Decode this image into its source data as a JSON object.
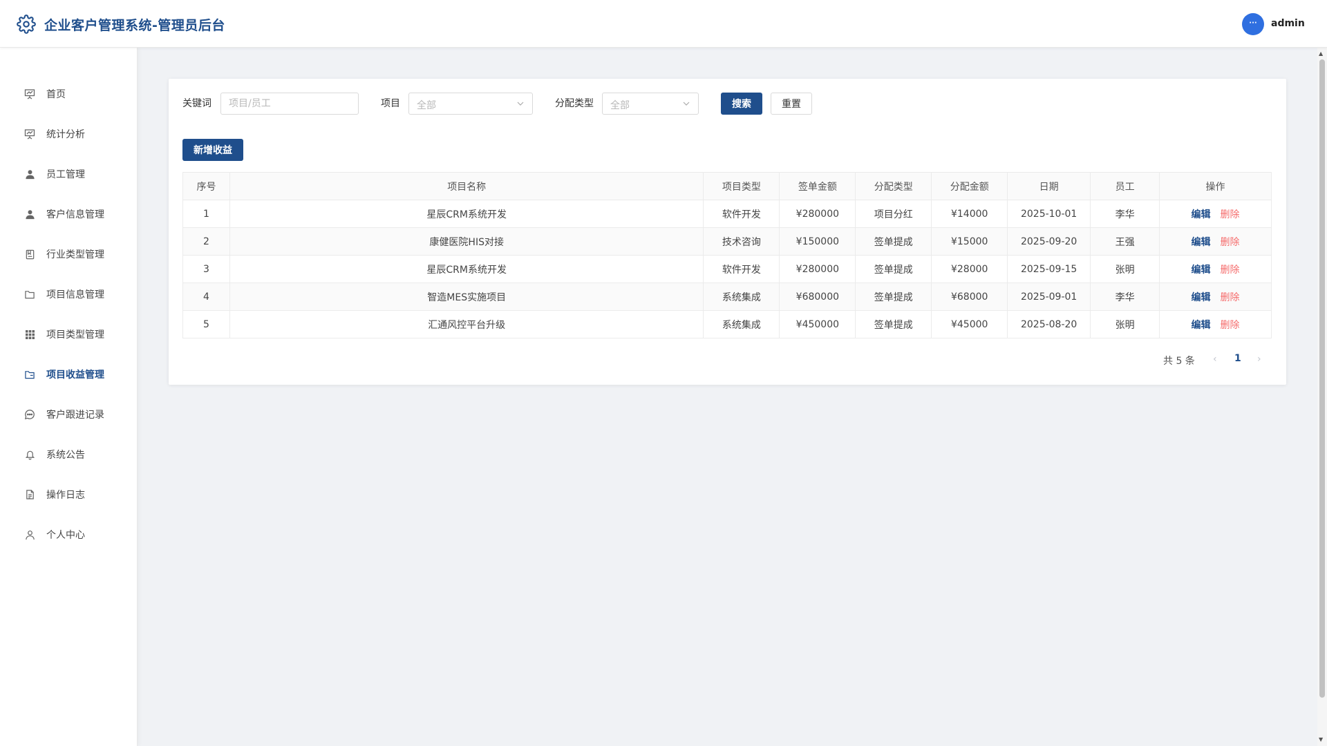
{
  "header": {
    "title": "企业客户管理系统-管理员后台",
    "avatar_text": "···",
    "username": "admin"
  },
  "sidebar": {
    "items": [
      {
        "label": "首页",
        "icon": "presentation-icon"
      },
      {
        "label": "统计分析",
        "icon": "chart-board-icon"
      },
      {
        "label": "员工管理",
        "icon": "user-filled-icon"
      },
      {
        "label": "客户信息管理",
        "icon": "user-filled-icon"
      },
      {
        "label": "行业类型管理",
        "icon": "notebook-icon"
      },
      {
        "label": "项目信息管理",
        "icon": "folder-icon"
      },
      {
        "label": "项目类型管理",
        "icon": "grid-icon"
      },
      {
        "label": "项目收益管理",
        "icon": "folder-open-icon",
        "active": true
      },
      {
        "label": "客户跟进记录",
        "icon": "chat-icon"
      },
      {
        "label": "系统公告",
        "icon": "bell-icon"
      },
      {
        "label": "操作日志",
        "icon": "document-icon"
      },
      {
        "label": "个人中心",
        "icon": "user-outline-icon"
      }
    ]
  },
  "filters": {
    "keyword_label": "关键词",
    "keyword_placeholder": "项目/员工",
    "project_label": "项目",
    "project_value": "全部",
    "type_label": "分配类型",
    "type_value": "全部",
    "search_label": "搜索",
    "reset_label": "重置"
  },
  "add_button_label": "新增收益",
  "table": {
    "columns": [
      "序号",
      "项目名称",
      "项目类型",
      "签单金额",
      "分配类型",
      "分配金额",
      "日期",
      "员工",
      "操作"
    ],
    "rows": [
      [
        "1",
        "星辰CRM系统开发",
        "软件开发",
        "¥280000",
        "项目分红",
        "¥14000",
        "2025-10-01",
        "李华"
      ],
      [
        "2",
        "康健医院HIS对接",
        "技术咨询",
        "¥150000",
        "签单提成",
        "¥15000",
        "2025-09-20",
        "王强"
      ],
      [
        "3",
        "星辰CRM系统开发",
        "软件开发",
        "¥280000",
        "签单提成",
        "¥28000",
        "2025-09-15",
        "张明"
      ],
      [
        "4",
        "智造MES实施项目",
        "系统集成",
        "¥680000",
        "签单提成",
        "¥68000",
        "2025-09-01",
        "李华"
      ],
      [
        "5",
        "汇通风控平台升级",
        "系统集成",
        "¥450000",
        "签单提成",
        "¥45000",
        "2025-08-20",
        "张明"
      ]
    ],
    "edit_label": "编辑",
    "delete_label": "删除"
  },
  "pagination": {
    "total_text": "共 5 条",
    "current_page": "1"
  },
  "colors": {
    "primary": "#1f4e8c",
    "danger": "#f56c6c",
    "avatar": "#2f6fe0"
  }
}
